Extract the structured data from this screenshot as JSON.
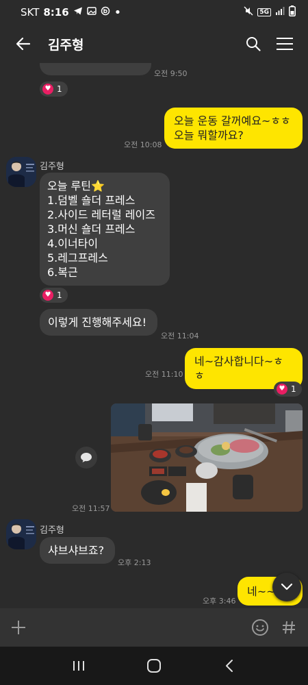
{
  "status": {
    "carrier": "SKT",
    "time": "8:16",
    "network": "5G"
  },
  "header": {
    "title": "김주형"
  },
  "chat": {
    "partial_ts": "오전 9:50",
    "partial_reaction": "1",
    "msg1": {
      "text": "오늘 운동 갈꺼예요~ㅎㅎ\n오늘 뭐할까요?",
      "ts": "오전 10:08"
    },
    "sender_name": "김주형",
    "routine": {
      "text": "오늘 루틴⭐\n1.덤벨 숄더 프레스\n2.사이드 레터럴 레이즈\n3.머신 숄더 프레스\n4.이너타이\n5.레그프레스\n6.복근",
      "reaction": "1"
    },
    "msg_please": {
      "text": "이렇게 진행해주세요!",
      "ts": "오전 11:04"
    },
    "msg_thanks": {
      "text": "네~감사합니다~ㅎㅎ",
      "ts": "오전 11:10",
      "reaction": "1"
    },
    "photo_ts": "오전 11:57",
    "sender_name2": "김주형",
    "msg_shabu": {
      "text": "샤브샤브죠?",
      "ts": "오후 2:13"
    },
    "msg_last": {
      "text": "네~~",
      "ts": "오후 3:46"
    }
  },
  "input": {
    "placeholder": ""
  },
  "colors": {
    "background": "#2b2b2b",
    "bubble_in": "#3f3f3f",
    "bubble_out": "#fee500",
    "heart": "#e91e63"
  }
}
